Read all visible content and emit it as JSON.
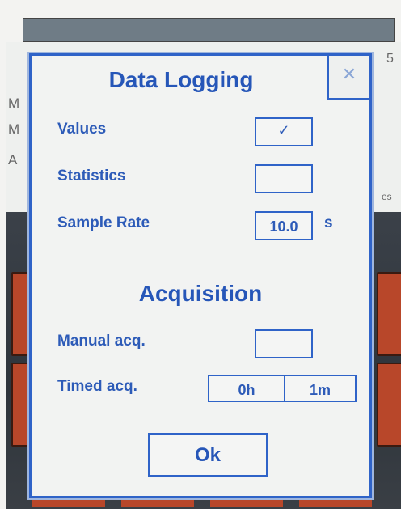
{
  "background": {
    "left_letters": [
      "M",
      "M",
      "A"
    ],
    "right_digit": "5",
    "right_fragment": "es"
  },
  "dialog": {
    "title": "Data Logging",
    "close_icon": "close-x-icon",
    "rows": {
      "values": {
        "label": "Values",
        "checked": true,
        "mark": "✓"
      },
      "statistics": {
        "label": "Statistics",
        "checked": false,
        "mark": ""
      },
      "sample_rate": {
        "label": "Sample Rate",
        "value": "10.0",
        "unit": "s"
      }
    },
    "acquisition": {
      "title": "Acquisition",
      "manual": {
        "label": "Manual acq.",
        "checked": false,
        "mark": ""
      },
      "timed": {
        "label": "Timed acq.",
        "hours": "0h",
        "minutes": "1m"
      }
    },
    "ok_label": "Ok"
  },
  "colors": {
    "accent": "#2f63c8",
    "text": "#2d5bb8",
    "button_red": "#b8472a"
  }
}
